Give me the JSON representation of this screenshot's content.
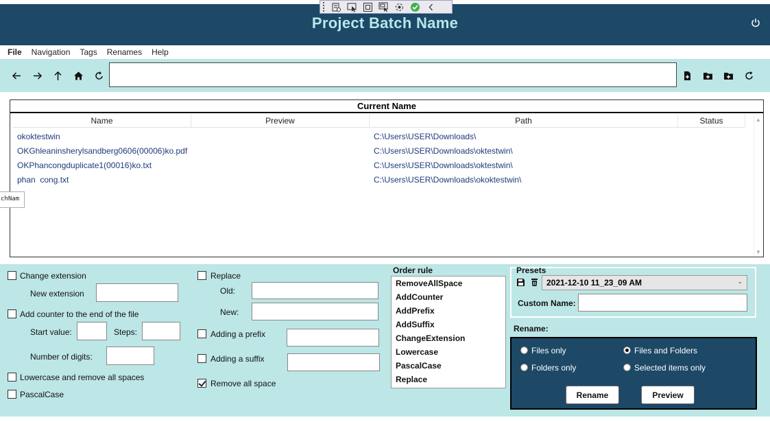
{
  "app": {
    "title": "Project Batch Name"
  },
  "menu": [
    "File",
    "Navigation",
    "Tags",
    "Renames",
    "Help"
  ],
  "path": {
    "value": ""
  },
  "list": {
    "header": "Current Name",
    "columns": [
      "Name",
      "Preview",
      "Path",
      "Status"
    ],
    "rows": [
      {
        "name": "okoktestwin",
        "preview": "",
        "path": "C:\\Users\\USER\\Downloads\\",
        "status": ""
      },
      {
        "name": "OKGhleaninsherylsandberg0606(00006)ko.pdf",
        "preview": "",
        "path": "C:\\Users\\USER\\Downloads\\oktestwin\\",
        "status": ""
      },
      {
        "name": "OKPhancongduplicate1(00016)ko.txt",
        "preview": "",
        "path": "C:\\Users\\USER\\Downloads\\oktestwin\\",
        "status": ""
      },
      {
        "name": "phan  cong.txt",
        "preview": "",
        "path": "C:\\Users\\USER\\Downloads\\okoktestwin\\",
        "status": ""
      }
    ]
  },
  "tooltip": "chNam",
  "options": {
    "change_extension": {
      "label": "Change extension",
      "checked": false,
      "new_ext_label": "New extension",
      "new_ext_value": ""
    },
    "add_counter": {
      "label": "Add counter to the end of the file",
      "checked": false,
      "start_label": "Start value:",
      "steps_label": "Steps:",
      "digits_label": "Number of digits:"
    },
    "lowercase": {
      "label": "Lowercase and remove all spaces",
      "checked": false
    },
    "pascalcase": {
      "label": "PascalCase",
      "checked": false
    },
    "replace": {
      "label": "Replace",
      "checked": false,
      "old_label": "Old:",
      "new_label": "New:"
    },
    "prefix": {
      "label": "Adding a prefix",
      "checked": false
    },
    "suffix": {
      "label": "Adding a suffix",
      "checked": false
    },
    "remove_space": {
      "label": "Remove all space",
      "checked": true
    }
  },
  "order_rule": {
    "title": "Order rule",
    "items": [
      "RemoveAllSpace",
      "AddCounter",
      "AddPrefix",
      "AddSuffix",
      "ChangeExtension",
      "Lowercase",
      "PascalCase",
      "Replace"
    ]
  },
  "presets": {
    "title": "Presets",
    "selected": "2021-12-10 11_23_09 AM",
    "custom_name_label": "Custom Name:",
    "custom_name_value": ""
  },
  "rename": {
    "title": "Rename:",
    "options": [
      "Files only",
      "Files and Folders",
      "Folders only",
      "Selected items only"
    ],
    "selected": "Files and Folders",
    "rename_button": "Rename",
    "preview_button": "Preview"
  },
  "colors": {
    "title_bg": "#1d4866",
    "title_fg": "#b9e6ea",
    "panel_bg": "#bde6e6"
  }
}
